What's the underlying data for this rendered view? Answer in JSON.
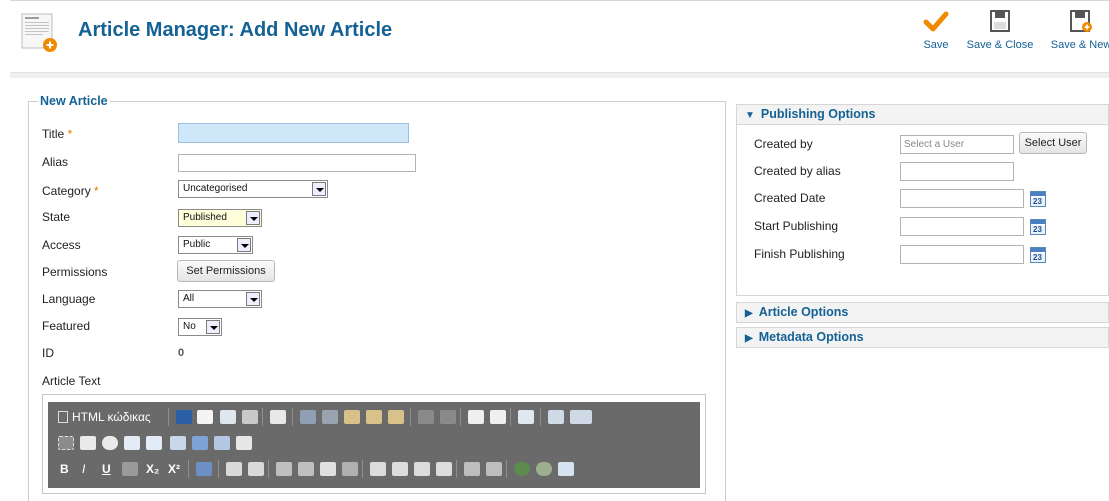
{
  "header": {
    "title": "Article Manager: Add New Article",
    "icon": "article-add-icon",
    "buttons": [
      {
        "label": "Save",
        "icon": "check-icon"
      },
      {
        "label": "Save & Close",
        "icon": "save-icon"
      },
      {
        "label": "Save & New",
        "icon": "save-new-icon"
      }
    ]
  },
  "form": {
    "legend": "New Article",
    "title_label": "Title",
    "title_value": "",
    "alias_label": "Alias",
    "alias_value": "",
    "category_label": "Category",
    "category_value": "Uncategorised",
    "state_label": "State",
    "state_value": "Published",
    "access_label": "Access",
    "access_value": "Public",
    "permissions_label": "Permissions",
    "permissions_button": "Set Permissions",
    "language_label": "Language",
    "language_value": "All",
    "featured_label": "Featured",
    "featured_value": "No",
    "id_label": "ID",
    "id_value": "0",
    "article_text_label": "Article Text",
    "required_marker": "*"
  },
  "editor": {
    "html_label": "HTML κώδικας"
  },
  "publishing": {
    "heading": "Publishing Options",
    "created_by_label": "Created by",
    "created_by_placeholder": "Select a User",
    "select_user_button": "Select User",
    "created_by_alias_label": "Created by alias",
    "created_date_label": "Created Date",
    "start_publishing_label": "Start Publishing",
    "finish_publishing_label": "Finish Publishing",
    "calendar_day": "23"
  },
  "article_options": {
    "heading": "Article Options"
  },
  "metadata_options": {
    "heading": "Metadata Options"
  },
  "colors": {
    "accent": "#146295",
    "required": "#e47b00",
    "title_field_bg": "#cfe8f9",
    "editor_toolbar": "#6a6a6a"
  }
}
